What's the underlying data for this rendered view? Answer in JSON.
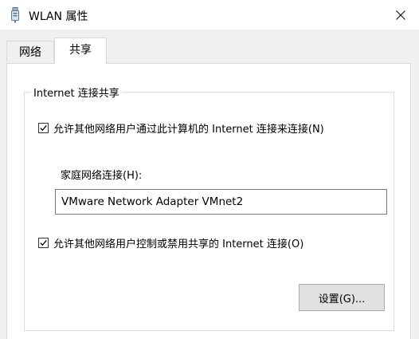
{
  "window": {
    "title": "WLAN 属性",
    "icon": "wlan-adapter-icon",
    "close_icon": "close-icon"
  },
  "tabs": [
    {
      "label": "网络",
      "selected": false
    },
    {
      "label": "共享",
      "selected": true
    }
  ],
  "sharing": {
    "group_title": "Internet 连接共享",
    "allow_connect": {
      "label": "允许其他网络用户通过此计算机的 Internet 连接来连接(N)",
      "checked": true
    },
    "home_network_label": "家庭网络连接(H):",
    "home_network_value": "VMware Network Adapter VMnet2",
    "allow_control": {
      "label": "允许其他网络用户控制或禁用共享的 Internet 连接(O)",
      "checked": true
    },
    "settings_button": "设置(G)..."
  }
}
